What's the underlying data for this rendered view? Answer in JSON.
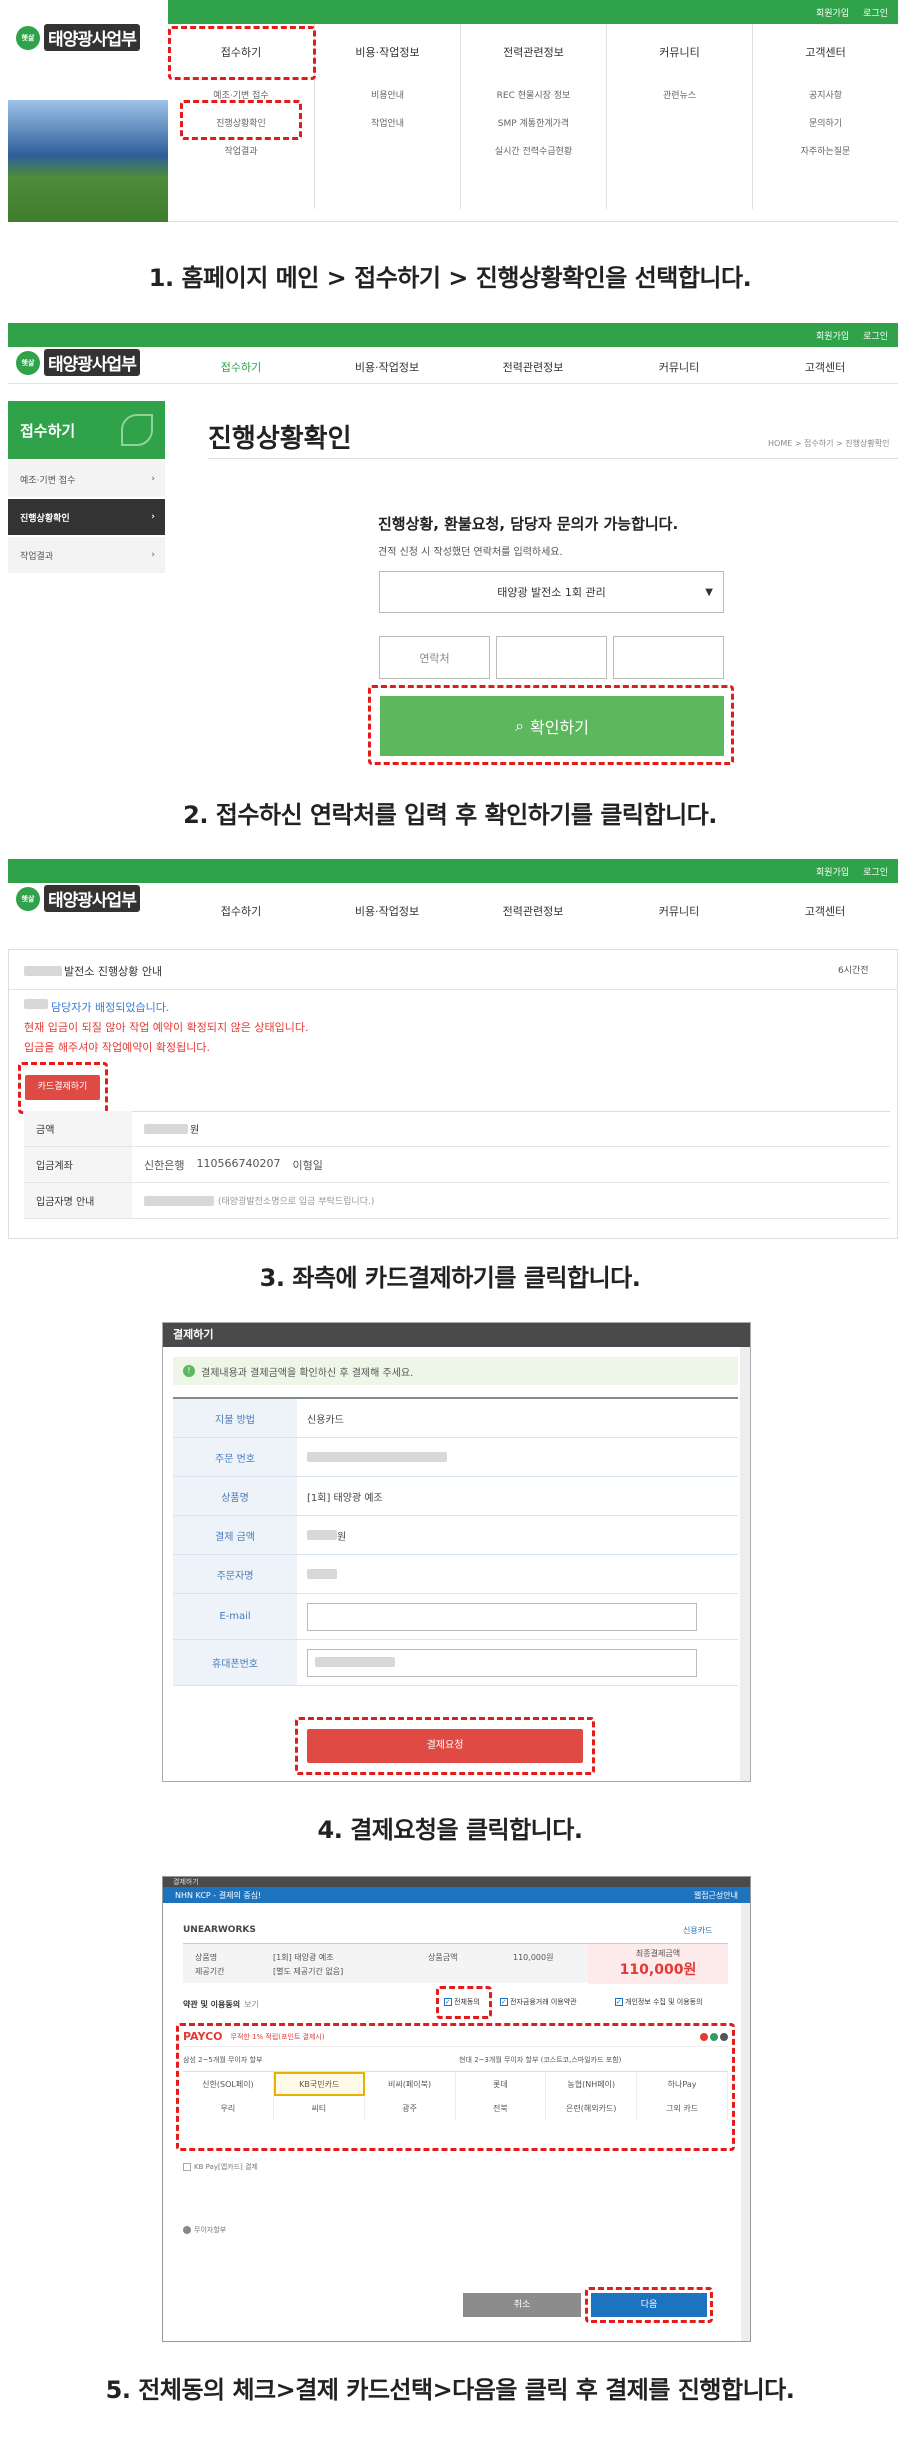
{
  "site": {
    "logo_badge": "햇살\n가득",
    "logo_name": "태양광사업부",
    "login": "로그인",
    "join": "회원가입",
    "nav": [
      "접수하기",
      "비용·작업정보",
      "전력관련정보",
      "커뮤니티",
      "고객센터"
    ],
    "submenus": [
      [
        "예조·기변 접수",
        "진행상황확인",
        "작업결과"
      ],
      [
        "비용안내",
        "작업안내"
      ],
      [
        "REC 현물시장 정보",
        "SMP 계통한계가격",
        "실시간 전력수급현황"
      ],
      [
        "관련뉴스"
      ],
      [
        "공지사항",
        "문의하기",
        "자주하는질문"
      ]
    ]
  },
  "captions": [
    "1. 홈페이지 메인 > 접수하기 > 진행상황확인을 선택합니다.",
    "2. 접수하신 연락처를 입력 후 확인하기를 클릭합니다.",
    "3. 좌측에 카드결제하기를 클릭합니다.",
    "4. 결제요청을 클릭합니다.",
    "5. 전체동의 체크>결제 카드선택>다음을 클릭 후 결제를 진행합니다."
  ],
  "step2": {
    "side_title": "접수하기",
    "side_items": [
      "예조·기변 접수",
      "진행상황확인",
      "작업결과"
    ],
    "page_title": "진행상황확인",
    "breadcrumb": "HOME > 접수하기 > 진행상황확인",
    "heading": "진행상황, 환불요청, 담당자 문의가 가능합니다.",
    "desc": "견적 신청 시 작성했던 연락처를 입력하세요.",
    "select": "태양광 발전소 1회 관리",
    "phone_placeholder": "연락처",
    "confirm": "확인하기"
  },
  "step3": {
    "title": "발전소 진행상황 안내",
    "time": "6시간전",
    "notice1": "담당자가 배정되었습니다.",
    "notice2": "현재 입금이 되질 않아 작업 예약이 확정되지 않은 상태입니다.",
    "notice3": "입금을 해주셔야 작업예약이 확정됩니다.",
    "card_btn": "카드결제하기",
    "rows": [
      {
        "label": "금액",
        "value": "원"
      },
      {
        "label": "입금계좌",
        "bank": "신한은행",
        "account": "110566740207",
        "holder": "이형일"
      },
      {
        "label": "입금자명 안내",
        "value": "(태양광발전소명으로 입금 부탁드립니다.)"
      }
    ]
  },
  "step4": {
    "window_title": "결제하기",
    "info": "결제내용과 결제금액을 확인하신 후 결제해 주세요.",
    "rows": [
      {
        "label": "지불 방법",
        "value": "신용카드"
      },
      {
        "label": "주문 번호",
        "value": ""
      },
      {
        "label": "상품명",
        "value": "[1회] 태양광 예조"
      },
      {
        "label": "결제 금액",
        "value": "원"
      },
      {
        "label": "주문자명",
        "value": ""
      },
      {
        "label": "E-mail",
        "value": ""
      },
      {
        "label": "휴대폰번호",
        "value": ""
      }
    ],
    "pay_btn": "결제요청"
  },
  "step5": {
    "hdr_title": "결제하기",
    "hdr_left": "NHN KCP - 결제의 중심!",
    "hdr_right": "웹접근성안내",
    "merchant": "UNEARWORKS",
    "card_link": "신용카드",
    "product_label": "상품명",
    "product": "[1회] 태양광 예조",
    "period_label": "제공기간",
    "period": "[별도 제공기간 없음]",
    "amount_label": "상품금액",
    "amount": "110,000원",
    "total_label": "최종결제금액",
    "total": "110,000원",
    "terms": "약관 및 이용동의",
    "view": "보기",
    "agree_all": "전체동의",
    "agree_e": "전자금융거래 이용약관",
    "agree_p": "개인정보 수집 및 이용동의",
    "payco": "PAYCO",
    "payco_desc": "무적한 1% 적립(포인트 결제시)",
    "samsung": "삼성 2~5개월 무이자 할부",
    "hyundai": "현대 2~3개월 무이자 할부 (코스트코,스마일카드 포함)",
    "cards": [
      "신한(SOL페이)",
      "KB국민카드",
      "비씨(페이북)",
      "롯데",
      "농협(NH페이)",
      "하나Pay",
      "우리",
      "씨티",
      "광주",
      "전북",
      "은련(해외카드)",
      "그외 카드"
    ],
    "kbpay": "KB Pay[앱카드] 결제",
    "help": "무이자할부",
    "cancel": "취소",
    "next": "다음"
  }
}
